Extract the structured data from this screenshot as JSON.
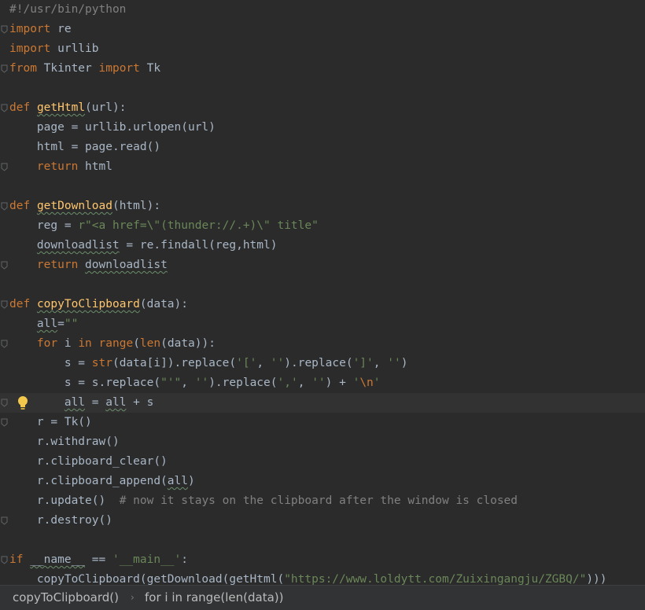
{
  "editor": {
    "language": "python",
    "lines": [
      "#!/usr/bin/python",
      "import re",
      "import urllib",
      "from Tkinter import Tk",
      "",
      "def getHtml(url):",
      "    page = urllib.urlopen(url)",
      "    html = page.read()",
      "    return html",
      "",
      "def getDownload(html):",
      "    reg = r\"<a href=\\\"(thunder://.+)\\\" title\"",
      "    downloadlist = re.findall(reg,html)",
      "    return downloadlist",
      "",
      "def copyToClipboard(data):",
      "    all=\"\"",
      "    for i in range(len(data)):",
      "        s = str(data[i]).replace('[', '').replace(']', '')",
      "        s = s.replace(\"'\", '').replace(',', '') + '\\n'",
      "        all = all + s",
      "    r = Tk()",
      "    r.withdraw()",
      "    r.clipboard_clear()",
      "    r.clipboard_append(all)",
      "    r.update()  # now it stays on the clipboard after the window is closed",
      "    r.destroy()",
      "",
      "if __name__ == '__main__':",
      "    copyToClipboard(getDownload(getHtml(\"https://www.loldytt.com/Zuixingangju/ZGBQ/\")))"
    ],
    "current_line": 21,
    "intention_icon": "lightbulb-icon"
  },
  "breadcrumb": {
    "items": [
      "copyToClipboard()",
      "for i in range(len(data))"
    ],
    "separator_icon": "chevron-right-icon"
  },
  "colors": {
    "background": "#2b2b2b",
    "keyword": "#cc7832",
    "function_name": "#ffc66d",
    "string": "#6a8759",
    "comment": "#808080",
    "text": "#a9b7c6"
  }
}
